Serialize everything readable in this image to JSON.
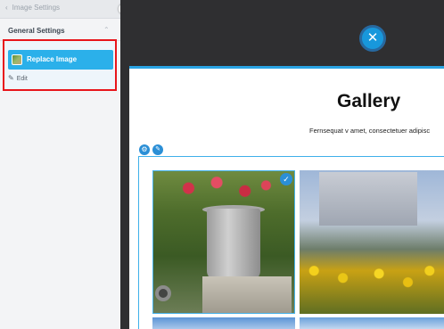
{
  "sidebar": {
    "back_label": "Image Settings",
    "section_title": "General Settings",
    "replace_label": "Replace Image",
    "edit_label": "Edit"
  },
  "canvas": {
    "close_symbol": "✕",
    "title": "Gallery",
    "subtitle": "Fernsequat v amet, consectetuer adipisc"
  },
  "icons": {
    "back": "chevron-left-icon",
    "section_toggle": "chevron-up-icon",
    "edit": "pencil-icon",
    "collapse": "chevron-left-icon",
    "settings": "gear-icon",
    "selected": "check-icon"
  },
  "colors": {
    "accent": "#2bb0ea",
    "highlight_border": "#e8151b",
    "editor_bg": "#2f2f31"
  }
}
